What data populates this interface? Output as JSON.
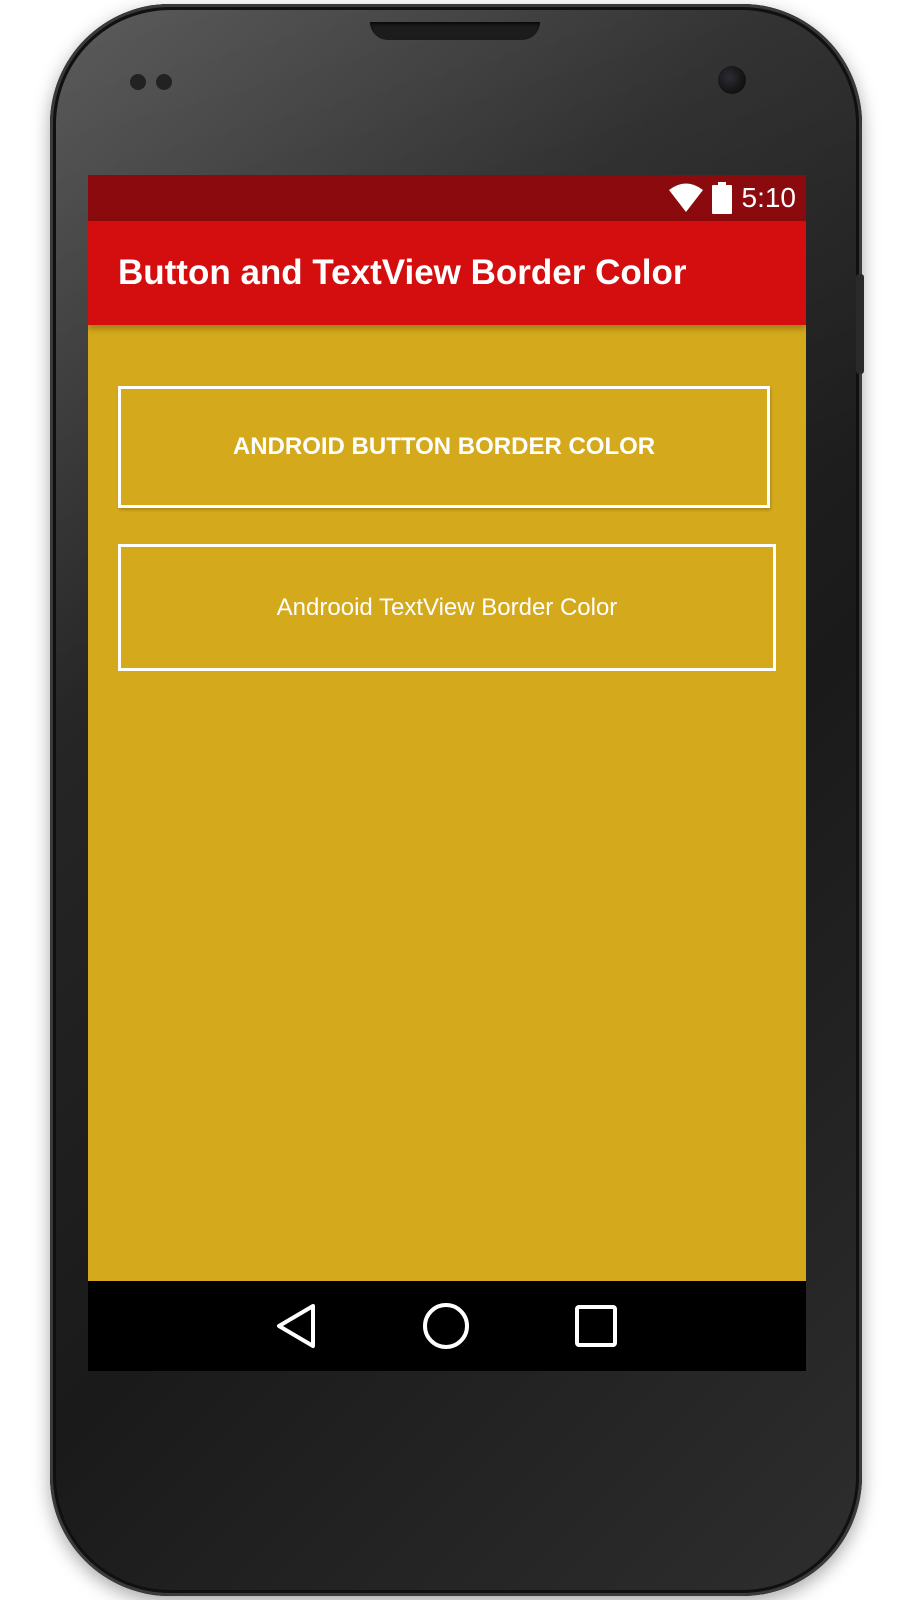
{
  "status_bar": {
    "time": "5:10",
    "icons": [
      "wifi-icon",
      "battery-icon"
    ]
  },
  "app_bar": {
    "title": "Button and TextView Border Color"
  },
  "content": {
    "button_label": "ANDROID BUTTON BORDER COLOR",
    "textview_text": "Androoid TextView Border Color"
  },
  "nav_bar": {
    "icons": [
      "back-icon",
      "home-icon",
      "recents-icon"
    ]
  },
  "colors": {
    "status_bar": "#8a0a0e",
    "app_bar": "#d40e0e",
    "background": "#d5a91c",
    "border": "#ffffff",
    "text": "#ffffff"
  }
}
